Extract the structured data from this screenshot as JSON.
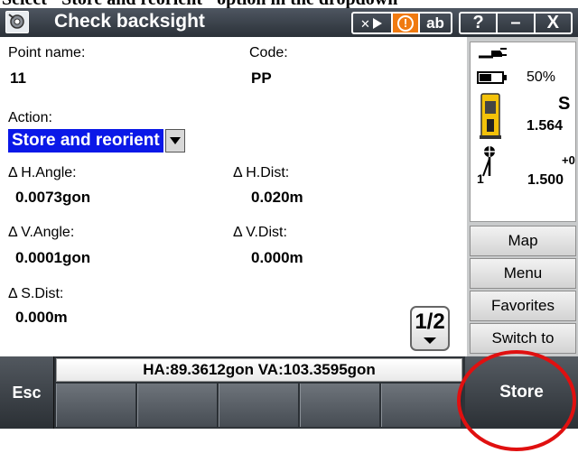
{
  "caption": "Select \"Store and reorient\" option in the dropdown",
  "window": {
    "title": "Check backsight",
    "app_icon": "instrument-icon",
    "buttons": {
      "connection": "✕",
      "alert": "!",
      "input_mode": "ab",
      "help": "?",
      "minimize": "–",
      "close": "X"
    }
  },
  "form": {
    "point_name_label": "Point name:",
    "point_name_value": "11",
    "code_label": "Code:",
    "code_value": "PP",
    "action_label": "Action:",
    "action_value": "Store and reorient",
    "h_angle_label": "Δ H.Angle:",
    "h_angle_value": "0.0073gon",
    "h_dist_label": "Δ H.Dist:",
    "h_dist_value": "0.020m",
    "v_angle_label": "Δ V.Angle:",
    "v_angle_value": "0.0001gon",
    "v_dist_label": "Δ V.Dist:",
    "v_dist_value": "0.000m",
    "s_dist_label": "Δ S.Dist:",
    "s_dist_value": "0.000m",
    "page_indicator": "1/2"
  },
  "status": {
    "battery": "50%",
    "instrument_mode": "S",
    "target_height": "1.564",
    "station_offset": "+0",
    "station_number": "1",
    "instrument_height": "1.500"
  },
  "side_buttons": [
    "Map",
    "Menu",
    "Favorites",
    "Switch to"
  ],
  "bottom": {
    "esc_label": "Esc",
    "readout": "HA:89.3612gon  VA:103.3595gon",
    "store_label": "Store"
  },
  "colors": {
    "titlebar": "#3a4048",
    "selection": "#0a18e8",
    "highlight_circle": "#e01010"
  }
}
